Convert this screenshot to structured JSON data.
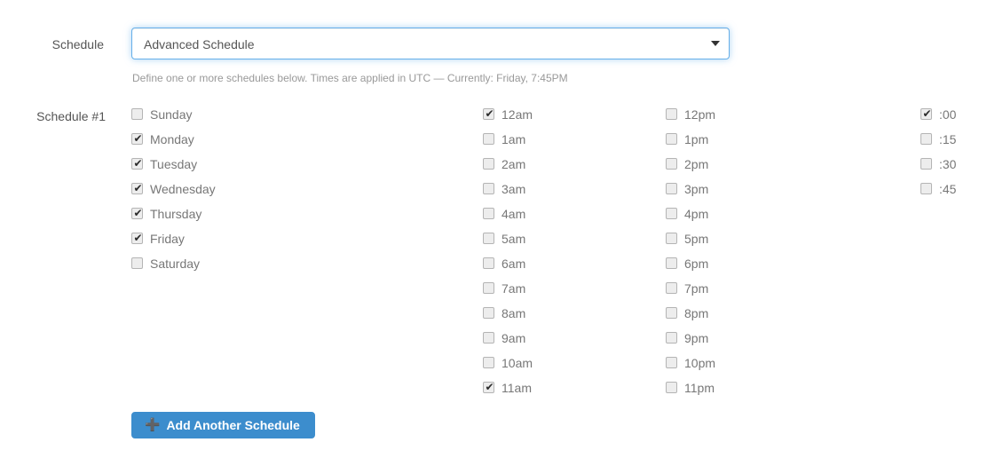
{
  "form": {
    "schedule_label": "Schedule",
    "select": {
      "value": "Advanced Schedule",
      "caret_icon": "chevron-down-icon"
    },
    "help_text": "Define one or more schedules below. Times are applied in UTC — Currently: Friday, 7:45PM"
  },
  "schedule": {
    "title": "Schedule #1",
    "days": [
      {
        "label": "Sunday",
        "checked": false
      },
      {
        "label": "Monday",
        "checked": true
      },
      {
        "label": "Tuesday",
        "checked": true
      },
      {
        "label": "Wednesday",
        "checked": true
      },
      {
        "label": "Thursday",
        "checked": true
      },
      {
        "label": "Friday",
        "checked": true
      },
      {
        "label": "Saturday",
        "checked": false
      }
    ],
    "hours_am": [
      {
        "label": "12am",
        "checked": true
      },
      {
        "label": "1am",
        "checked": false
      },
      {
        "label": "2am",
        "checked": false
      },
      {
        "label": "3am",
        "checked": false
      },
      {
        "label": "4am",
        "checked": false
      },
      {
        "label": "5am",
        "checked": false
      },
      {
        "label": "6am",
        "checked": false
      },
      {
        "label": "7am",
        "checked": false
      },
      {
        "label": "8am",
        "checked": false
      },
      {
        "label": "9am",
        "checked": false
      },
      {
        "label": "10am",
        "checked": false
      },
      {
        "label": "11am",
        "checked": true
      }
    ],
    "hours_pm": [
      {
        "label": "12pm",
        "checked": false
      },
      {
        "label": "1pm",
        "checked": false
      },
      {
        "label": "2pm",
        "checked": false
      },
      {
        "label": "3pm",
        "checked": false
      },
      {
        "label": "4pm",
        "checked": false
      },
      {
        "label": "5pm",
        "checked": false
      },
      {
        "label": "6pm",
        "checked": false
      },
      {
        "label": "7pm",
        "checked": false
      },
      {
        "label": "8pm",
        "checked": false
      },
      {
        "label": "9pm",
        "checked": false
      },
      {
        "label": "10pm",
        "checked": false
      },
      {
        "label": "11pm",
        "checked": false
      }
    ],
    "minutes": [
      {
        "label": ":00",
        "checked": true
      },
      {
        "label": ":15",
        "checked": false
      },
      {
        "label": ":30",
        "checked": false
      },
      {
        "label": ":45",
        "checked": false
      }
    ]
  },
  "actions": {
    "add_schedule": {
      "icon": "plus-icon",
      "icon_glyph": "➕",
      "label": "Add Another Schedule"
    }
  },
  "colors": {
    "accent_blue": "#3c8dcd",
    "focus_border": "#66afe9",
    "text": "#555555",
    "muted_text": "#777777",
    "help_text": "#999999",
    "background": "#ffffff"
  }
}
